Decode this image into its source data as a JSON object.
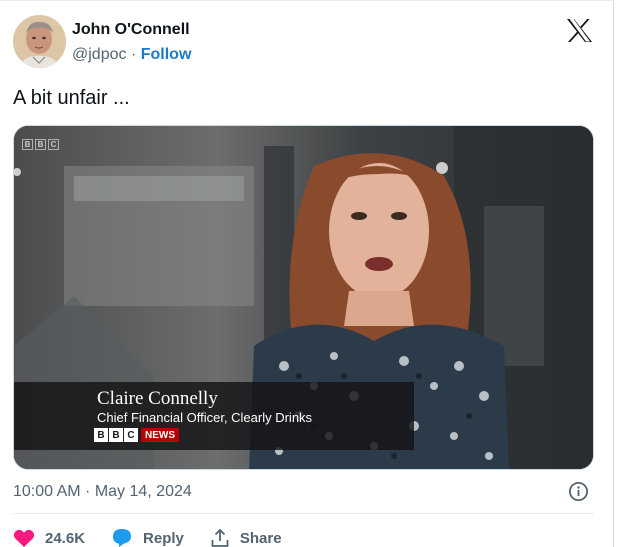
{
  "author": {
    "name": "John O'Connell",
    "handle": "@jdpoc",
    "separator": "·",
    "follow_label": "Follow"
  },
  "tweet": {
    "text": "A bit unfair ...",
    "timestamp": "10:00 AM · May 14, 2024"
  },
  "media": {
    "corner_logo": [
      "B",
      "B",
      "C"
    ],
    "caption_name": "Claire Connelly",
    "caption_title": "Chief Financial Officer, Clearly Drinks",
    "channel_letters": [
      "B",
      "B",
      "C"
    ],
    "channel_news": "NEWS"
  },
  "actions": {
    "likes": "24.6K",
    "reply_label": "Reply",
    "share_label": "Share"
  },
  "colors": {
    "like_heart": "#f91880",
    "reply_bubble": "#1d9bf0",
    "follow_link": "#1d7bc8",
    "news_red": "#b80000"
  },
  "icons": {
    "logo": "x-logo-icon",
    "like": "heart-icon",
    "reply": "speech-bubble-icon",
    "share": "share-upload-icon",
    "info": "info-icon"
  }
}
